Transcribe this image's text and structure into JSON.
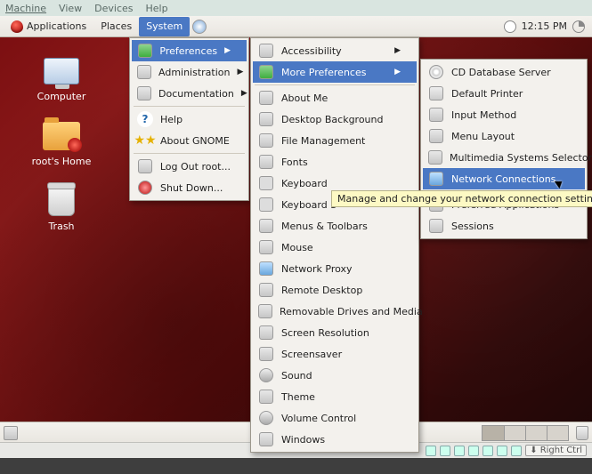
{
  "vm_menu": {
    "machine": "Machine",
    "view": "View",
    "devices": "Devices",
    "help": "Help"
  },
  "panel": {
    "applications": "Applications",
    "places": "Places",
    "system": "System",
    "clock": "12:15 PM"
  },
  "desktop_icons": {
    "computer": "Computer",
    "home": "root's Home",
    "trash": "Trash"
  },
  "system_menu": {
    "preferences": "Preferences",
    "administration": "Administration",
    "documentation": "Documentation",
    "help": "Help",
    "about_gnome": "About GNOME",
    "logout": "Log Out root...",
    "shutdown": "Shut Down..."
  },
  "preferences_menu": {
    "accessibility": "Accessibility",
    "more_preferences": "More Preferences",
    "about_me": "About Me",
    "desktop_background": "Desktop Background",
    "file_management": "File Management",
    "fonts": "Fonts",
    "keyboard": "Keyboard",
    "keyboard_shortcuts_partial": "Keyboard S",
    "menus_toolbars": "Menus & Toolbars",
    "mouse": "Mouse",
    "network_proxy": "Network Proxy",
    "remote_desktop": "Remote Desktop",
    "removable": "Removable Drives and Media",
    "screen_resolution": "Screen Resolution",
    "screensaver": "Screensaver",
    "sound": "Sound",
    "theme": "Theme",
    "volume_control": "Volume Control",
    "windows": "Windows"
  },
  "more_prefs_menu": {
    "cd_database": "CD Database Server",
    "default_printer": "Default Printer",
    "input_method": "Input Method",
    "menu_layout": "Menu Layout",
    "mm_selector": "Multimedia Systems Selector",
    "network_connections": "Network Connections",
    "preferred_apps": "Preferred Applications",
    "sessions": "Sessions"
  },
  "tooltip": {
    "network_connections": "Manage and change your network connection settings"
  },
  "vm_status": {
    "right_ctrl": "Right Ctrl"
  }
}
